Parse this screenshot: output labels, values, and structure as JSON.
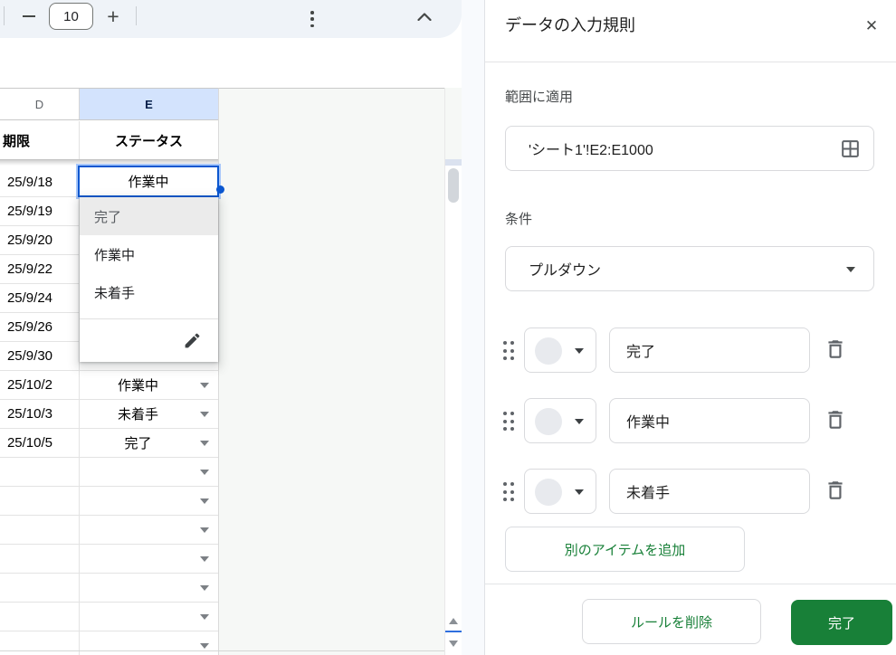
{
  "toolbar": {
    "zoom_value": "10"
  },
  "sheet": {
    "column_headers": [
      "D",
      "E"
    ],
    "field_headers": {
      "d": "期限",
      "e": "ステータス"
    },
    "selected_cell_value": "作業中",
    "rows": [
      {
        "date": "25/9/18",
        "status": "作業中"
      },
      {
        "date": "25/9/19",
        "status": ""
      },
      {
        "date": "25/9/20",
        "status": ""
      },
      {
        "date": "25/9/22",
        "status": ""
      },
      {
        "date": "25/9/24",
        "status": ""
      },
      {
        "date": "25/9/26",
        "status": ""
      },
      {
        "date": "25/9/30",
        "status": ""
      },
      {
        "date": "25/10/2",
        "status": "作業中"
      },
      {
        "date": "25/10/3",
        "status": "未着手"
      },
      {
        "date": "25/10/5",
        "status": "完了"
      },
      {
        "date": "",
        "status": ""
      },
      {
        "date": "",
        "status": ""
      },
      {
        "date": "",
        "status": ""
      },
      {
        "date": "",
        "status": ""
      },
      {
        "date": "",
        "status": ""
      },
      {
        "date": "",
        "status": ""
      },
      {
        "date": "",
        "status": ""
      }
    ],
    "cell_dropdown": {
      "items": [
        "完了",
        "作業中",
        "未着手"
      ],
      "highlighted_item": "完了"
    }
  },
  "panel": {
    "title": "データの入力規則",
    "range_section": {
      "label": "範囲に適用",
      "value": "'シート1'!E2:E1000"
    },
    "criteria_section": {
      "label": "条件",
      "selected_option": "プルダウン"
    },
    "items": [
      {
        "value": "完了"
      },
      {
        "value": "作業中"
      },
      {
        "value": "未着手"
      }
    ],
    "add_item_label": "別のアイテムを追加",
    "delete_rule_label": "ルールを削除",
    "done_label": "完了"
  },
  "colors": {
    "accent_blue": "#0b57d0",
    "selection_halo": "#a8c7fa",
    "selected_column_header_bg": "#d3e3fd",
    "green": "#188038"
  }
}
